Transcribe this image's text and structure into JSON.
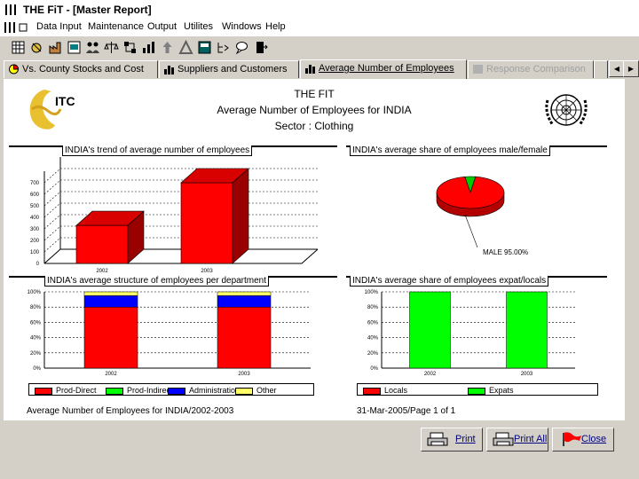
{
  "window": {
    "title": "THE FiT - [Master Report]"
  },
  "menu": [
    "Data Input",
    "Maintenance",
    "Output",
    "Utilites",
    "Windows",
    "Help"
  ],
  "toolbar": {
    "icons": [
      "grid-icon",
      "hand-icon",
      "factory-icon",
      "form-icon",
      "people-icon",
      "scales-icon",
      "network-icon",
      "arrow-up-icon",
      "triangle-icon",
      "sheet-icon",
      "comment-icon",
      "door-exit-icon"
    ]
  },
  "tabs": [
    {
      "label": "Vs. County Stocks and Cost"
    },
    {
      "label": "Suppliers and Customers"
    },
    {
      "label": "Average Number of Employees"
    },
    {
      "label": "Response Comparison"
    }
  ],
  "report": {
    "header_line1": "THE FIT",
    "header_line2": "Average Number of Employees for INDIA",
    "header_line3": "Sector : Clothing",
    "logo_text": "ITC",
    "footer_left": "Average Number of Employees for INDIA/2002-2003",
    "footer_right": "31-Mar-2005/Page 1 of 1"
  },
  "chart_data": [
    {
      "type": "bar",
      "title": "INDIA's trend of average number of employees",
      "categories": [
        "2002",
        "2003"
      ],
      "values": [
        330,
        700
      ],
      "ylim": [
        0,
        800
      ],
      "yticks": [
        "0",
        "100",
        "200",
        "300",
        "400",
        "500",
        "600",
        "700"
      ],
      "grid": true,
      "color": "#ff0000"
    },
    {
      "type": "pie",
      "title": "INDIA's average share of employees male/female",
      "slices": [
        {
          "label": "MALE",
          "value": 95.0,
          "color": "#ff0000"
        },
        {
          "value": 5.0,
          "color": "#00cc00"
        }
      ],
      "annotation": "MALE  95.00%"
    },
    {
      "type": "bar",
      "title": "INDIA's average structure of employees per department",
      "categories": [
        "2002",
        "2003"
      ],
      "series": [
        {
          "name": "Prod-Direct",
          "values": [
            80,
            80
          ],
          "color": "#ff0000"
        },
        {
          "name": "Prod-Indirect",
          "values": [
            0,
            0
          ],
          "color": "#00ff00"
        },
        {
          "name": "Administratio",
          "values": [
            15,
            15
          ],
          "color": "#0000ff"
        },
        {
          "name": "Other",
          "values": [
            5,
            5
          ],
          "color": "#ffff66"
        }
      ],
      "ylim": [
        0,
        100
      ],
      "yticks": [
        "0%",
        "20%",
        "40%",
        "60%",
        "80%",
        "100%"
      ],
      "grid": true
    },
    {
      "type": "bar",
      "title": "INDIA's average share of employees expat/locals",
      "categories": [
        "2002",
        "2003"
      ],
      "series": [
        {
          "name": "Locals",
          "values": [
            0,
            0
          ],
          "color": "#ff0000"
        },
        {
          "name": "Expats",
          "values": [
            100,
            100
          ],
          "color": "#00ff00"
        }
      ],
      "ylim": [
        0,
        100
      ],
      "yticks": [
        "0%",
        "20%",
        "40%",
        "60%",
        "80%",
        "100%"
      ],
      "grid": true
    }
  ],
  "buttons": {
    "print": "Print",
    "print_all": "Print All",
    "close": "Close"
  }
}
